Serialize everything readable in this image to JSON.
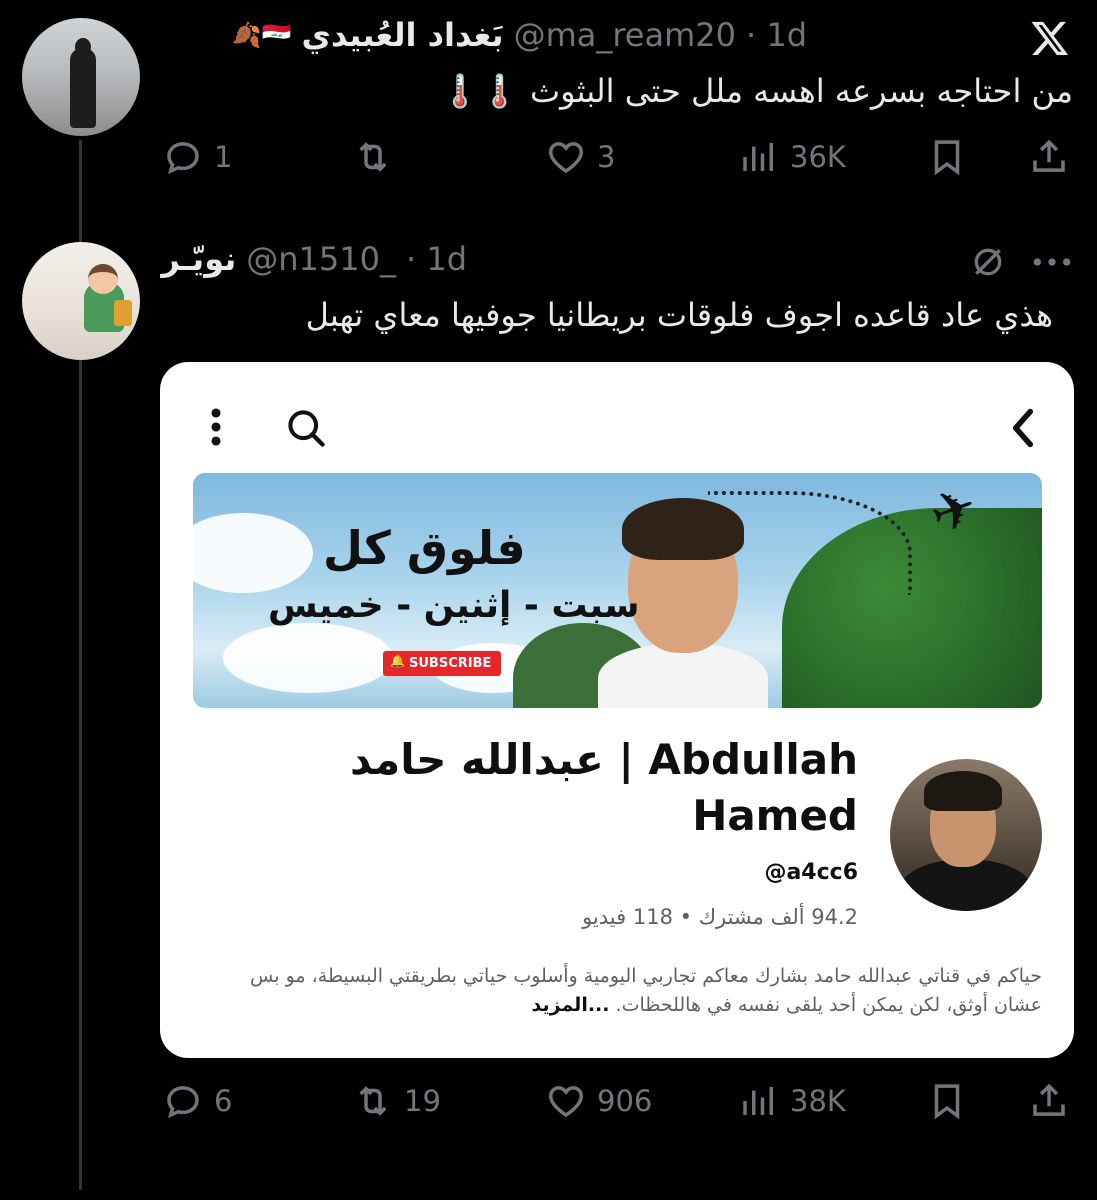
{
  "tweet1": {
    "display_name": "بَغداد العُبيدي",
    "name_emoji": "🍂🇮🇶",
    "handle": "@ma_ream20",
    "time": "· 1d",
    "text": "من احتاجه بسرعه اهسه ملل حتى البثوث",
    "text_emoji": "🌡️🌡️",
    "actions": {
      "replies": "1",
      "retweets": "",
      "likes": "3",
      "views": "36K"
    }
  },
  "tweet2": {
    "display_name": "نويّـر",
    "handle": "@n1510_",
    "time": "· 1d",
    "text": "هذي عاد قاعده اجوف فلوقات بريطانيا جوفيها معاي تهبل",
    "actions": {
      "replies": "6",
      "retweets": "19",
      "likes": "906",
      "views": "38K"
    }
  },
  "card": {
    "banner_title": "فلوق كل",
    "banner_subtitle": "سبت - إثنين - خميس",
    "subscribe_label": "SUBSCRIBE",
    "channel_name": "عبدالله حامد | Abdullah Hamed",
    "channel_handle": "@a4cc6",
    "channel_stats": "94.2 ألف مشترك • 118 فيديو",
    "description": "حياكم في قناتي عبدالله حامد بشارك معاكم تجاربي اليومية وأسلوب حياتي بطريقتي البسيطة، مو بس عشان أوثق، لكن يمكن أحد يلقى نفسه في هاللحظات. ",
    "more_label": "...المزيد"
  },
  "colors": {
    "background": "#000000",
    "text": "#e7e9ea",
    "muted": "#71767b",
    "card": "#ffffff"
  }
}
